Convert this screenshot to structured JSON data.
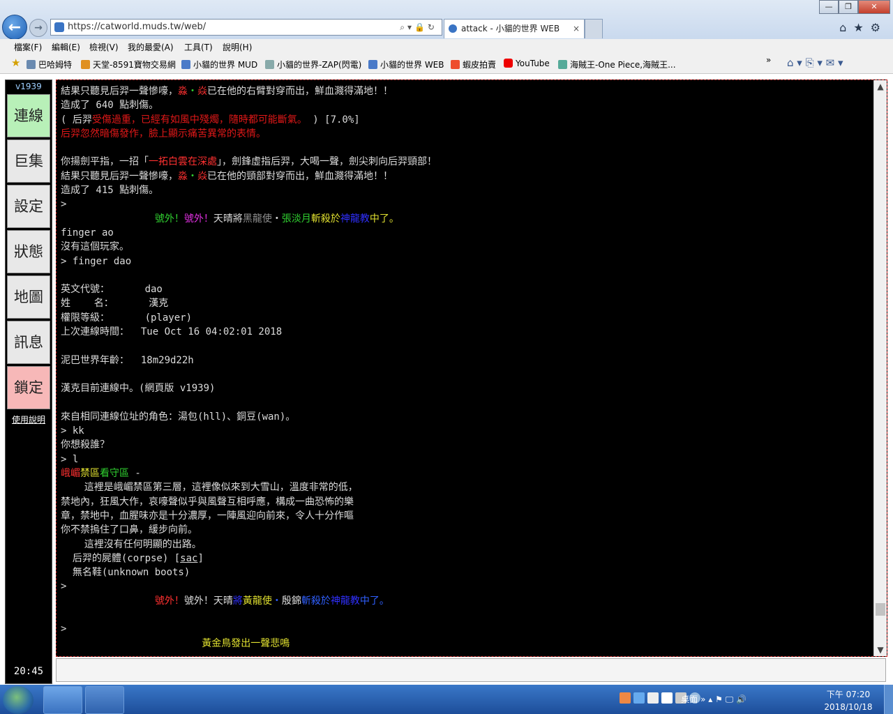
{
  "browser": {
    "url": "https://catworld.muds.tw/web/",
    "tab_title": "attack - 小貓的世界 WEB",
    "tab_close": "×",
    "window_controls": [
      "—",
      "❐",
      "✕"
    ],
    "nav_icons": [
      "home-icon",
      "star-icon",
      "gear-icon"
    ],
    "menu": [
      "檔案(F)",
      "編輯(E)",
      "檢視(V)",
      "我的最愛(A)",
      "工具(T)",
      "說明(H)"
    ],
    "favorites": [
      "巴哈姆特",
      "天堂-8591寶物交易網",
      "小貓的世界 MUD",
      "小貓的世界-ZAP(閃電)",
      "小貓的世界 WEB",
      "蝦皮拍賣",
      "YouTube",
      "海賊王-One Piece,海賊王..."
    ],
    "favorites_more": "»",
    "back_glyph": "←",
    "forward_glyph": "→"
  },
  "sidebar": {
    "version": "v1939",
    "buttons": [
      "連線",
      "巨集",
      "設定",
      "狀態",
      "地圖",
      "訊息",
      "鎖定"
    ],
    "help": "使用說明",
    "clock": "20:45"
  },
  "terminal": {
    "lines": [
      [
        {
          "t": "結果只聽見后羿一聲慘嚎，",
          "c": "#dcdcdc"
        },
        {
          "t": "淼",
          "c": "#ff3030"
        },
        {
          "t": "・",
          "c": "#30d030"
        },
        {
          "t": "焱",
          "c": "#ff3030"
        },
        {
          "t": "已在他的右臂對穿而出，鮮血濺得滿地！！",
          "c": "#dcdcdc"
        }
      ],
      [
        {
          "t": "造成了 640 點刺傷。",
          "c": "#dcdcdc"
        }
      ],
      [
        {
          "t": "( 后羿",
          "c": "#dcdcdc"
        },
        {
          "t": "受傷過重，已經有如風中殘燭，隨時都可能斷氣。",
          "c": "#e01818"
        },
        {
          "t": " ) [7.0%]",
          "c": "#dcdcdc"
        }
      ],
      [
        {
          "t": "后羿忽然暗傷發作，臉上顯示痛苦異常的表情。",
          "c": "#e01818"
        }
      ],
      [],
      [
        {
          "t": "你揚劍平指，一招「",
          "c": "#dcdcdc"
        },
        {
          "t": "一拓白雲在深處",
          "c": "#ff3030"
        },
        {
          "t": "」，劍鋒虛指后羿，大喝一聲，劍尖刺向后羿頸部！",
          "c": "#dcdcdc"
        }
      ],
      [
        {
          "t": "結果只聽見后羿一聲慘嚎，",
          "c": "#dcdcdc"
        },
        {
          "t": "淼",
          "c": "#ff3030"
        },
        {
          "t": "・",
          "c": "#30d030"
        },
        {
          "t": "焱",
          "c": "#ff3030"
        },
        {
          "t": "已在他的頸部對穿而出，鮮血濺得滿地！！",
          "c": "#dcdcdc"
        }
      ],
      [
        {
          "t": "造成了 415 點刺傷。",
          "c": "#dcdcdc"
        }
      ],
      [
        {
          "t": ">",
          "c": "#dcdcdc"
        }
      ],
      [
        {
          "t": "                ",
          "c": "#dcdcdc"
        },
        {
          "t": "號外！",
          "c": "#30d030"
        },
        {
          "t": "號外！",
          "c": "#e030e0"
        },
        {
          "t": "天晴將",
          "c": "#dcdcdc"
        },
        {
          "t": "黑龍使",
          "c": "#909090"
        },
        {
          "t": "・",
          "c": "#dcdcdc"
        },
        {
          "t": "張淡月",
          "c": "#30d030"
        },
        {
          "t": "斬殺於",
          "c": "#e0e030"
        },
        {
          "t": "神龍教",
          "c": "#3030ff"
        },
        {
          "t": "中了。",
          "c": "#e0e030"
        }
      ],
      [
        {
          "t": "finger ao",
          "c": "#dcdcdc"
        }
      ],
      [
        {
          "t": "沒有這個玩家。",
          "c": "#dcdcdc"
        }
      ],
      [
        {
          "t": "> finger dao",
          "c": "#dcdcdc"
        }
      ],
      [],
      [
        {
          "t": "英文代號：      dao",
          "c": "#dcdcdc"
        }
      ],
      [
        {
          "t": "姓    名：      漢克",
          "c": "#dcdcdc"
        }
      ],
      [
        {
          "t": "權限等級：      (player)",
          "c": "#dcdcdc"
        }
      ],
      [
        {
          "t": "上次連線時間：  Tue Oct 16 04:02:01 2018",
          "c": "#dcdcdc"
        }
      ],
      [],
      [
        {
          "t": "泥巴世界年齡：  18m29d22h",
          "c": "#dcdcdc"
        }
      ],
      [],
      [
        {
          "t": "漢克目前連線中。(網頁版 v1939)",
          "c": "#dcdcdc"
        }
      ],
      [],
      [
        {
          "t": "來自相同連線位址的角色：湯包(hll)、銅豆(wan)。",
          "c": "#dcdcdc"
        }
      ],
      [
        {
          "t": "> kk",
          "c": "#dcdcdc"
        }
      ],
      [
        {
          "t": "你想殺誰？",
          "c": "#dcdcdc"
        }
      ],
      [
        {
          "t": "> l",
          "c": "#dcdcdc"
        }
      ],
      [
        {
          "t": "峨嵋",
          "c": "#ff3030"
        },
        {
          "t": "禁區",
          "c": "#e0e030"
        },
        {
          "t": "看守區",
          "c": "#30d030"
        },
        {
          "t": " -",
          "c": "#dcdcdc"
        }
      ],
      [
        {
          "t": "    這裡是峨嵋禁區第三層，這裡像似來到大雪山，溫度非常的低，",
          "c": "#dcdcdc"
        }
      ],
      [
        {
          "t": "禁地內，狂風大作，哀嚎聲似乎與風聲互相呼應，構成一曲恐怖的樂",
          "c": "#dcdcdc"
        }
      ],
      [
        {
          "t": "章，禁地中，血腥味亦是十分濃厚，一陣風迎向前來，令人十分作嘔",
          "c": "#dcdcdc"
        }
      ],
      [
        {
          "t": "你不禁摀住了口鼻，緩步向前。",
          "c": "#dcdcdc"
        }
      ],
      [
        {
          "t": "    這裡沒有任何明顯的出路。",
          "c": "#dcdcdc"
        }
      ],
      [
        {
          "t": "  后羿的屍體(corpse) [",
          "c": "#dcdcdc"
        },
        {
          "t": "sac",
          "c": "#dcdcdc",
          "u": true
        },
        {
          "t": "]",
          "c": "#dcdcdc"
        }
      ],
      [
        {
          "t": "  無名鞋(unknown boots)",
          "c": "#dcdcdc"
        }
      ],
      [
        {
          "t": ">",
          "c": "#dcdcdc"
        }
      ],
      [
        {
          "t": "                ",
          "c": "#dcdcdc"
        },
        {
          "t": "號外！",
          "c": "#ff3030"
        },
        {
          "t": "號外！",
          "c": "#dcdcdc"
        },
        {
          "t": "天晴",
          "c": "#dcdcdc"
        },
        {
          "t": "將",
          "c": "#3030ff"
        },
        {
          "t": "黃龍使",
          "c": "#e0e030"
        },
        {
          "t": "・",
          "c": "#3060ff"
        },
        {
          "t": "殷錦",
          "c": "#dcdcdc"
        },
        {
          "t": "斬殺於",
          "c": "#3060ff"
        },
        {
          "t": "神龍教",
          "c": "#3030ff"
        },
        {
          "t": "中了。",
          "c": "#3060ff"
        }
      ],
      [],
      [
        {
          "t": ">",
          "c": "#dcdcdc"
        }
      ],
      [
        {
          "t": "                        ",
          "c": "#dcdcdc"
        },
        {
          "t": "黃金鳥發出一聲悲鳴",
          "c": "#e0e030"
        }
      ]
    ]
  },
  "taskbar": {
    "desktop": "桌面",
    "desktop_more": "»",
    "time": "下午 07:20",
    "date": "2018/10/18"
  }
}
